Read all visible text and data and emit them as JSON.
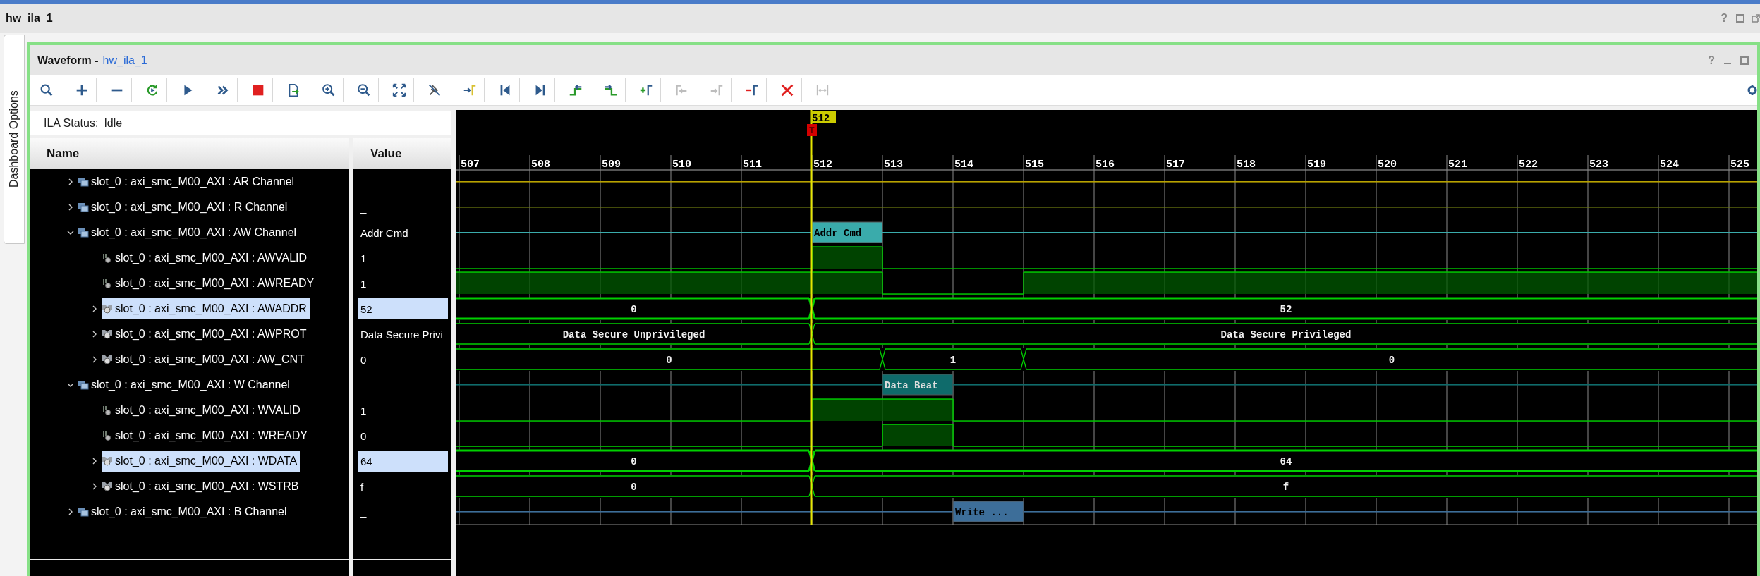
{
  "window": {
    "title": "hw_ila_1",
    "help": "?"
  },
  "side_tab": {
    "label": "Dashboard Options"
  },
  "panel": {
    "title": "Waveform -",
    "link": "hw_ila_1",
    "help": "?"
  },
  "toolbar": [
    {
      "disabled": false
    },
    {
      "disabled": false
    },
    {
      "disabled": false
    },
    {
      "disabled": false
    },
    {
      "disabled": false
    },
    {
      "disabled": false
    },
    {
      "disabled": false
    },
    {
      "disabled": false
    },
    {
      "disabled": false
    },
    {
      "disabled": false
    },
    {
      "disabled": false
    },
    {
      "disabled": false
    },
    {
      "disabled": false
    },
    {
      "disabled": false
    },
    {
      "disabled": false
    },
    {
      "disabled": false
    },
    {
      "disabled": false
    },
    {
      "disabled": false
    },
    {
      "disabled": true
    },
    {
      "disabled": true
    },
    {
      "disabled": false
    },
    {
      "disabled": false
    },
    {
      "disabled": true
    }
  ],
  "status": {
    "label": "ILA Status:",
    "value": "Idle"
  },
  "columns": [
    "Name",
    "Value"
  ],
  "waveform": {
    "ticks": [
      "507",
      "508",
      "509",
      "510",
      "511",
      "512",
      "513",
      "514",
      "515",
      "516",
      "517",
      "518",
      "519",
      "520",
      "521",
      "522",
      "523",
      "524",
      "525"
    ],
    "cursor": "512",
    "trigger": "T"
  },
  "signals": [
    {
      "name": "slot_0 : axi_smc_M00_AXI : AR Channel",
      "value": "_",
      "kind": "group",
      "expanded": false,
      "selected": false,
      "color": "#b8a200"
    },
    {
      "name": "slot_0 : axi_smc_M00_AXI : R Channel",
      "value": "_",
      "kind": "group",
      "expanded": false,
      "selected": false,
      "color": "#6f7d12"
    },
    {
      "name": "slot_0 : axi_smc_M00_AXI : AW Channel",
      "value": "Addr Cmd",
      "kind": "group",
      "expanded": true,
      "selected": false,
      "color": "#3aabab",
      "transactions": [
        {
          "label": "Addr Cmd"
        }
      ],
      "box": [
        false,
        false,
        false,
        false,
        false,
        true,
        false,
        false,
        false,
        false,
        false,
        false,
        false,
        false,
        false,
        false,
        false,
        false,
        false
      ],
      "children": [
        {
          "name": "slot_0 : axi_smc_M00_AXI : AWVALID",
          "value": "1",
          "kind": "bit",
          "selected": false,
          "high": [
            false,
            false,
            false,
            false,
            false,
            true,
            false,
            false,
            false,
            false,
            false,
            false,
            false,
            false,
            false,
            false,
            false,
            false,
            false
          ]
        },
        {
          "name": "slot_0 : axi_smc_M00_AXI : AWREADY",
          "value": "1",
          "kind": "bit",
          "selected": false,
          "high": [
            true,
            true,
            true,
            true,
            true,
            true,
            false,
            false,
            true,
            true,
            true,
            true,
            true,
            true,
            true,
            true,
            true,
            true,
            true
          ]
        },
        {
          "name": "slot_0 : axi_smc_M00_AXI : AWADDR",
          "value": "52",
          "kind": "bus",
          "expanded": false,
          "selected": true,
          "labels": [
            "0",
            "52"
          ],
          "changes": [
            false,
            false,
            false,
            false,
            false,
            true,
            false,
            false,
            false,
            false,
            false,
            false,
            false,
            false,
            false,
            false,
            false,
            false,
            false
          ]
        },
        {
          "name": "slot_0 : axi_smc_M00_AXI : AWPROT",
          "value": "Data Secure Privi",
          "kind": "bus",
          "expanded": false,
          "selected": false,
          "labels": [
            "Data Secure Unprivileged",
            "Data Secure Privileged"
          ],
          "changes": [
            false,
            false,
            false,
            false,
            false,
            true,
            false,
            false,
            false,
            false,
            false,
            false,
            false,
            false,
            false,
            false,
            false,
            false,
            false
          ]
        },
        {
          "name": "slot_0 : axi_smc_M00_AXI : AW_CNT",
          "value": "0",
          "kind": "bus",
          "expanded": false,
          "selected": false,
          "labels": [
            "0",
            "1",
            "0"
          ],
          "changes": [
            false,
            false,
            false,
            false,
            false,
            false,
            true,
            false,
            true,
            false,
            false,
            false,
            false,
            false,
            false,
            false,
            false,
            false,
            false
          ]
        }
      ]
    },
    {
      "name": "slot_0 : axi_smc_M00_AXI : W Channel",
      "value": "_",
      "kind": "group",
      "expanded": true,
      "selected": false,
      "color": "#0f6b6b",
      "transactions": [
        {
          "label": "Data Beat"
        }
      ],
      "box": [
        false,
        false,
        false,
        false,
        false,
        false,
        true,
        false,
        false,
        false,
        false,
        false,
        false,
        false,
        false,
        false,
        false,
        false,
        false
      ],
      "children": [
        {
          "name": "slot_0 : axi_smc_M00_AXI : WVALID",
          "value": "1",
          "kind": "bit",
          "selected": false,
          "high": [
            false,
            false,
            false,
            false,
            false,
            true,
            true,
            false,
            false,
            false,
            false,
            false,
            false,
            false,
            false,
            false,
            false,
            false,
            false
          ]
        },
        {
          "name": "slot_0 : axi_smc_M00_AXI : WREADY",
          "value": "0",
          "kind": "bit",
          "selected": false,
          "high": [
            false,
            false,
            false,
            false,
            false,
            false,
            true,
            false,
            false,
            false,
            false,
            false,
            false,
            false,
            false,
            false,
            false,
            false,
            false
          ]
        },
        {
          "name": "slot_0 : axi_smc_M00_AXI : WDATA",
          "value": "64",
          "kind": "bus",
          "expanded": false,
          "selected": true,
          "labels": [
            "0",
            "64"
          ],
          "changes": [
            false,
            false,
            false,
            false,
            false,
            true,
            false,
            false,
            false,
            false,
            false,
            false,
            false,
            false,
            false,
            false,
            false,
            false,
            false
          ]
        },
        {
          "name": "slot_0 : axi_smc_M00_AXI : WSTRB",
          "value": "f",
          "kind": "bus",
          "expanded": false,
          "selected": false,
          "labels": [
            "0",
            "f"
          ],
          "changes": [
            false,
            false,
            false,
            false,
            false,
            true,
            false,
            false,
            false,
            false,
            false,
            false,
            false,
            false,
            false,
            false,
            false,
            false,
            false
          ]
        }
      ]
    },
    {
      "name": "slot_0 : axi_smc_M00_AXI : B Channel",
      "value": "_",
      "kind": "group",
      "expanded": false,
      "selected": false,
      "color": "#3d6e99",
      "transactions": [
        {
          "label": "Write ..."
        }
      ],
      "box": [
        false,
        false,
        false,
        false,
        false,
        false,
        false,
        true,
        false,
        false,
        false,
        false,
        false,
        false,
        false,
        false,
        false,
        false,
        false
      ]
    }
  ]
}
